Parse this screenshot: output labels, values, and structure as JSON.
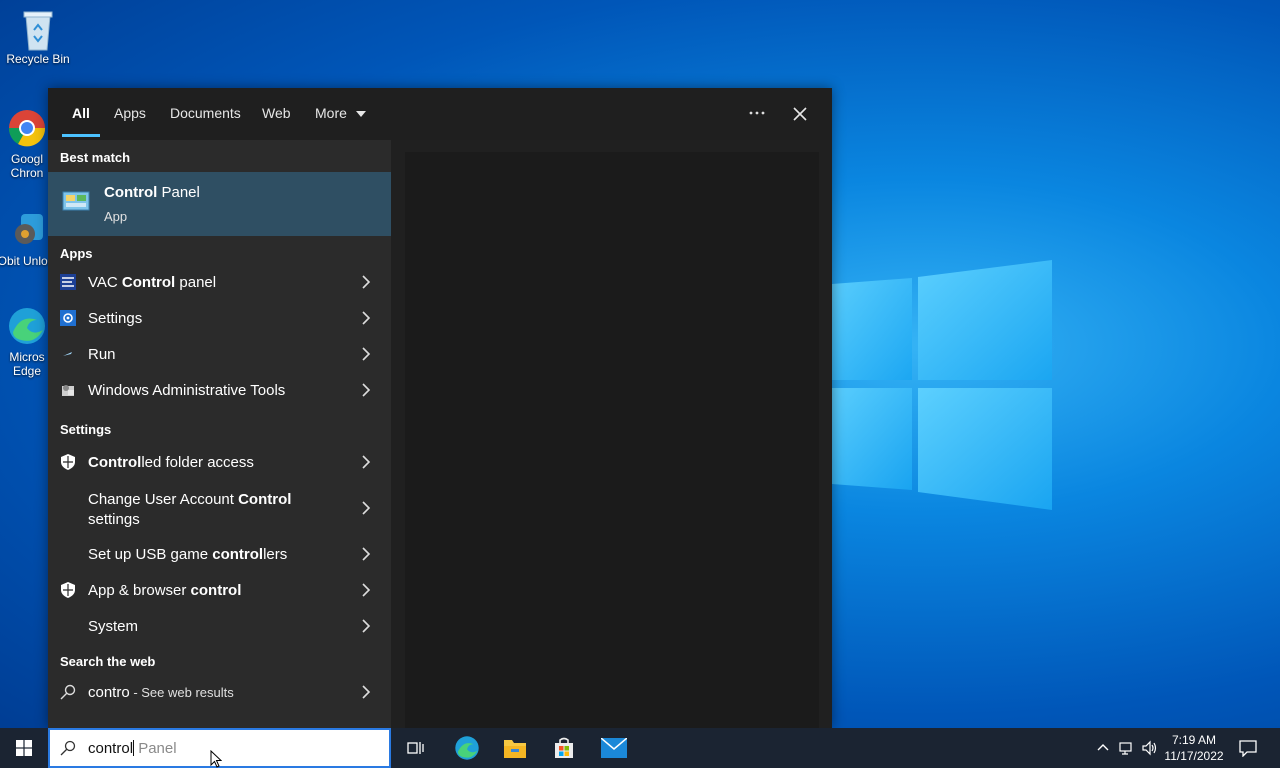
{
  "desktop": {
    "icons": [
      {
        "label": "Recycle Bin",
        "icon": "recycle-bin-icon"
      },
      {
        "label": "Googl Chron",
        "icon": "chrome-icon"
      },
      {
        "label": "IObit Unlock",
        "icon": "iobit-unlocker-icon"
      },
      {
        "label": "Micros Edge",
        "icon": "edge-icon"
      }
    ]
  },
  "search": {
    "tabs": [
      "All",
      "Apps",
      "Documents",
      "Web",
      "More"
    ],
    "best_match_header": "Best match",
    "best_match": {
      "title_bold": "Control",
      "title_rest": " Panel",
      "subtitle": "App"
    },
    "apps_header": "Apps",
    "apps": [
      {
        "pre": "VAC ",
        "bold": "Control",
        "post": " panel"
      },
      {
        "pre": "Settings",
        "bold": "",
        "post": ""
      },
      {
        "pre": "Run",
        "bold": "",
        "post": ""
      },
      {
        "pre": "Windows Administrative Tools",
        "bold": "",
        "post": ""
      }
    ],
    "settings_header": "Settings",
    "settings": [
      {
        "pre": "",
        "bold": "Control",
        "post": "led folder access"
      },
      {
        "pre": "Change User Account ",
        "bold": "Control",
        "post": "",
        "line2": "settings"
      },
      {
        "pre": "Set up USB game ",
        "bold": "control",
        "post": "lers"
      },
      {
        "pre": "App & browser ",
        "bold": "control",
        "post": ""
      },
      {
        "pre": "System",
        "bold": "",
        "post": ""
      }
    ],
    "web_header": "Search the web",
    "web": {
      "query": "contro",
      "suffix": " - See web results"
    },
    "input_typed": "control",
    "input_suggest": " Panel"
  },
  "tray": {
    "time": "7:19 AM",
    "date": "11/17/2022"
  },
  "colors": {
    "accent": "#4cc2ff",
    "selected": "#2f4f63",
    "taskbar": "#1b2432"
  }
}
